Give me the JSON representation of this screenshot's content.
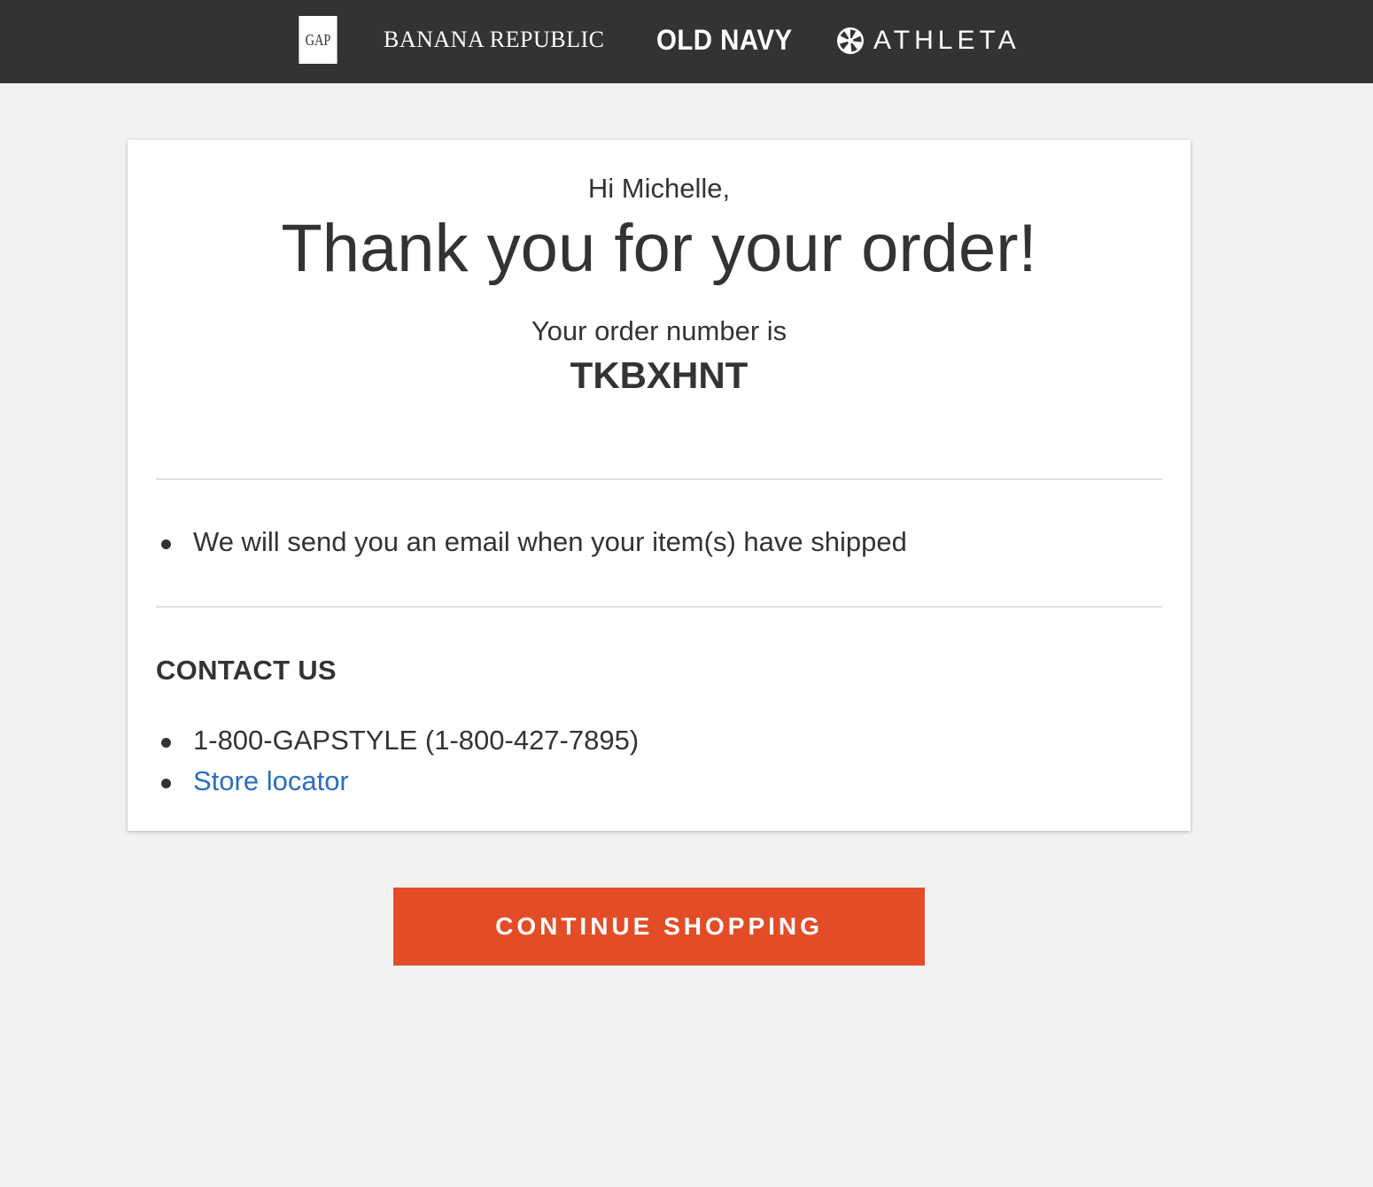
{
  "brands": {
    "gap": "GAP",
    "banana_republic": "BANANA REPUBLIC",
    "old_navy": "OLD NAVY",
    "athleta": "ATHLETA",
    "athleta_icon": "athleta-pinwheel-icon"
  },
  "confirmation": {
    "greeting": "Hi Michelle,",
    "headline": "Thank you for your order!",
    "order_number_label": "Your order number is",
    "order_number": "TKBXHNT"
  },
  "shipping_notes": [
    "We will send you an email when your item(s) have shipped"
  ],
  "contact": {
    "heading": "CONTACT US",
    "phone": "1-800-GAPSTYLE (1-800-427-7895)",
    "store_locator": "Store locator"
  },
  "actions": {
    "continue_shopping": "CONTINUE SHOPPING"
  },
  "colors": {
    "brand_bar": "#333333",
    "page_background": "#f2f2f2",
    "link": "#2a6ebd",
    "primary_button": "#e24d27"
  }
}
